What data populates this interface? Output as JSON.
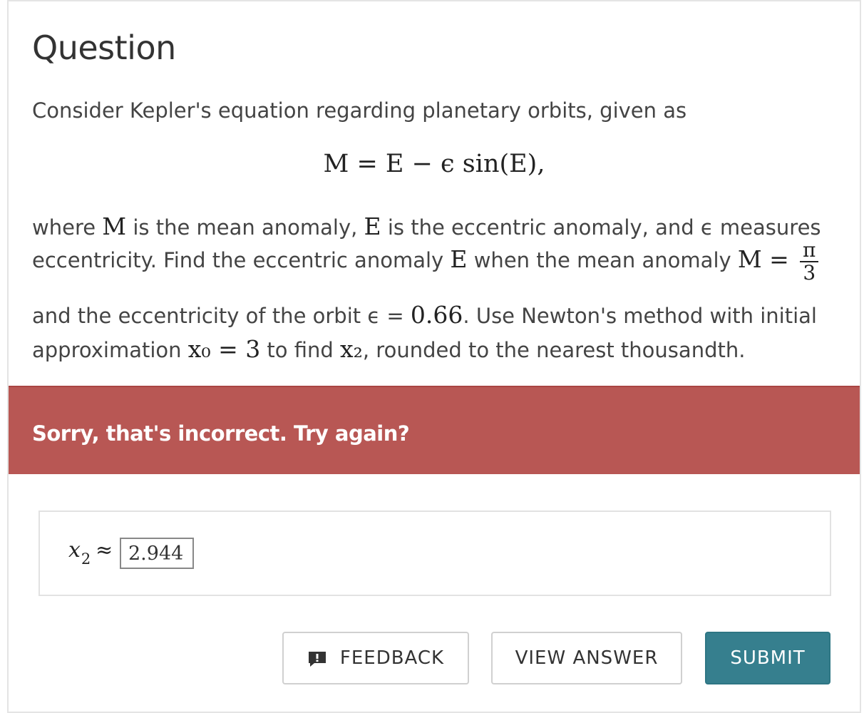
{
  "question": {
    "title": "Question",
    "intro": "Consider Kepler's equation regarding planetary orbits, given as",
    "equation": "M = E − ϵ sin(E),",
    "line1_a": "where",
    "line1_m": "M",
    "line1_b": "is the mean anomaly,",
    "line1_e": "E",
    "line1_c": "is the eccentric anomaly, and ϵ measures",
    "line2_a": "eccentricity. Find the eccentric anomaly",
    "line2_e": "E",
    "line2_b": "when the mean anomaly",
    "line2_m": "M =",
    "line2_num": "π",
    "line2_den": "3",
    "line3_a": "and the eccentricity of the orbit ϵ =",
    "line3_val": "0.66",
    "line3_b": ". Use Newton's method with initial",
    "line4_a": "approximation",
    "line4_x0": "x₀ = 3",
    "line4_b": "to find",
    "line4_x2": "x₂",
    "line4_c": ", rounded to the nearest thousandth."
  },
  "feedback": {
    "message": "Sorry, that's incorrect. Try again?",
    "color": "#b85754"
  },
  "answer": {
    "variable": "x",
    "subscript": "2",
    "relation": "≈",
    "value": "2.944"
  },
  "buttons": {
    "feedback_label": "FEEDBACK",
    "feedback_icon": "comment-exclamation-icon",
    "view_answer_label": "VIEW ANSWER",
    "submit_label": "SUBMIT",
    "submit_color": "#367f8e"
  }
}
